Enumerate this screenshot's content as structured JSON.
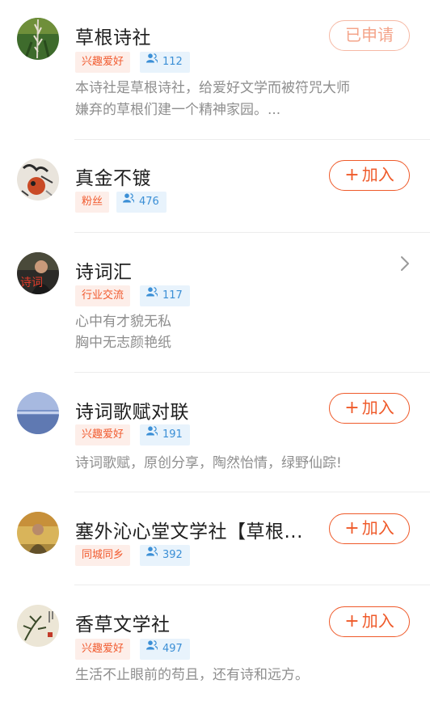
{
  "items": [
    {
      "name": "草根诗社",
      "tag": "兴趣爱好",
      "members": "112",
      "desc": [
        "本诗社是草根诗社，给爱好文学而被符咒大师",
        "嫌弃的草根们建一个精神家园。..."
      ],
      "action": "已申请"
    },
    {
      "name": "真金不镀",
      "tag": "粉丝",
      "members": "476",
      "desc": [],
      "action": "加入"
    },
    {
      "name": "诗词汇",
      "tag": "行业交流",
      "members": "117",
      "desc": [
        "心中有才貌无私",
        "胸中无志颜艳纸"
      ],
      "avatar_text": "诗词",
      "action": "chevron-right-icon"
    },
    {
      "name": "诗词歌赋对联",
      "tag": "兴趣爱好",
      "members": "191",
      "desc": [
        "诗词歌赋，原创分享，陶然怡情，绿野仙踪!"
      ],
      "action": "加入"
    },
    {
      "name": "塞外沁心堂文学社【草根...",
      "tag": "同城同乡",
      "members": "392",
      "desc": [],
      "action": "加入"
    },
    {
      "name": "香草文学社",
      "tag": "兴趣爱好",
      "members": "497",
      "desc": [
        "生活不止眼前的苟且，还有诗和远方。"
      ],
      "action": "加入"
    }
  ],
  "colors": {
    "accent": "#ef5a2a",
    "tag_bg": "#fdeee9",
    "count_text": "#3b8fd6",
    "count_bg": "#e8f3fc"
  }
}
